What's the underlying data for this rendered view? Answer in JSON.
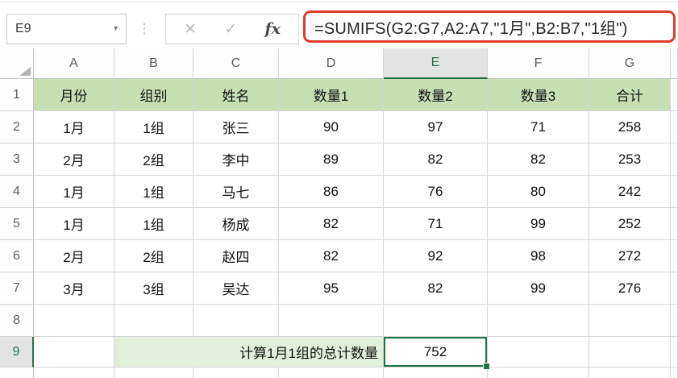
{
  "formula_bar": {
    "name_box": "E9",
    "formula": "=SUMIFS(G2:G7,A2:A7,\"1月\",B2:B7,\"1组\")",
    "icons": {
      "cancel": "✕",
      "enter": "✓",
      "insert_function": "fx",
      "name_box_dropdown": "▾",
      "more_handle": "⋮"
    }
  },
  "sheet": {
    "column_letters": [
      "A",
      "B",
      "C",
      "D",
      "E",
      "F",
      "G"
    ],
    "row_numbers": [
      "1",
      "2",
      "3",
      "4",
      "5",
      "6",
      "7",
      "8",
      "9"
    ],
    "selected_column": "E",
    "selected_row": "9",
    "selected_cell": "E9",
    "header_row": [
      "月份",
      "组别",
      "姓名",
      "数量1",
      "数量2",
      "数量3",
      "合计"
    ],
    "rows": [
      [
        "1月",
        "1组",
        "张三",
        "90",
        "97",
        "71",
        "258"
      ],
      [
        "2月",
        "2组",
        "李中",
        "89",
        "82",
        "82",
        "253"
      ],
      [
        "1月",
        "1组",
        "马七",
        "86",
        "76",
        "80",
        "242"
      ],
      [
        "1月",
        "1组",
        "杨成",
        "82",
        "71",
        "99",
        "252"
      ],
      [
        "2月",
        "2组",
        "赵四",
        "82",
        "92",
        "98",
        "272"
      ],
      [
        "3月",
        "3组",
        "吴达",
        "95",
        "82",
        "99",
        "276"
      ]
    ],
    "summary_label": "计算1月1组的总计数量",
    "result_value": "752"
  },
  "colors": {
    "header_fill": "#c6e0b4",
    "summary_fill": "#e2efda",
    "selection_green": "#217346",
    "formula_highlight_red": "#e23b28"
  }
}
